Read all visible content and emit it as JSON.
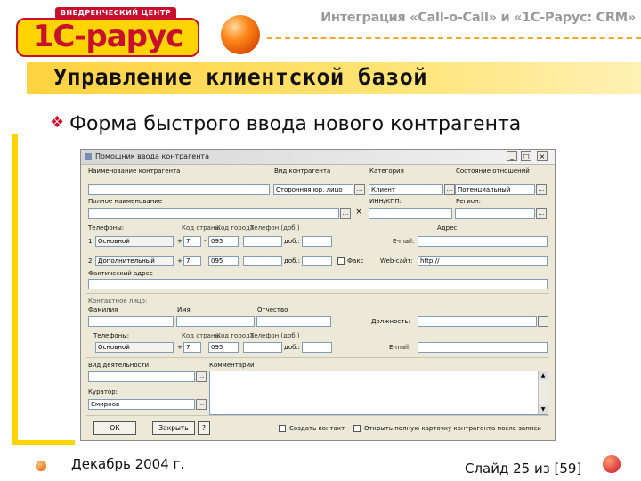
{
  "slide": {
    "logo_badge": "ВНЕДРЕНЧЕСКИЙ ЦЕНТР",
    "logo_brand": "1С-рарус",
    "header": "Интеграция «Call-o-Call» и «1С-Рарус: CRM»",
    "title": "Управление клиентской базой",
    "bullet_mark": "❖",
    "bullet": "Форма быстрого ввода нового контрагента",
    "footer_date": "Декабрь 2004 г.",
    "footer_slide": "Слайд 25 из [59]"
  },
  "colors": {
    "accent_yellow": "#ffd400",
    "accent_red": "#c8102e",
    "orange": "#f5a623"
  },
  "dialog": {
    "title": "Помощник ввода контрагента",
    "window_buttons": [
      "_",
      "□",
      "×"
    ],
    "labels": {
      "name": "Наименование контрагента",
      "kind": "Вид контрагента",
      "category": "Категория",
      "relation": "Состояние отношений",
      "full_name": "Полное наименование",
      "inn": "ИНН/КПП:",
      "region": "Регион:",
      "phones": "Телефоны:",
      "phone_hint_code": "Код страны",
      "phone_hint_city": "Код города",
      "phone_hint_number": "Телефон (доб.)",
      "address": "Адрес",
      "email": "E-mail:",
      "web": "Web-сайт:",
      "fax": "Факс",
      "actual_address": "Фактический адрес",
      "contact_section": "Контактное лицо:",
      "surname": "Фамилия",
      "firstname": "Имя",
      "patronymic": "Отчество",
      "position": "Должность:",
      "contact_phones": "Телефоны:",
      "contact_email": "E-mail:",
      "activity": "Вид деятельности:",
      "comments": "Комментарии",
      "curator": "Куратор:",
      "ext": "доб.:"
    },
    "values": {
      "kind": "Сторонняя юр. лицо",
      "category": "Клиент",
      "relation": "Потенциальный",
      "web": "http://",
      "curator": "Смирнов"
    },
    "phones": [
      {
        "num": "1",
        "type": "Основной",
        "plus": "+",
        "country": "7",
        "dash": "-",
        "city": "095"
      },
      {
        "num": "2",
        "type": "Дополнительный",
        "plus": "+",
        "country": "7",
        "dash": "",
        "city": "095"
      }
    ],
    "contact_phone": {
      "type": "Основной",
      "plus": "+",
      "country": "7",
      "city": "095"
    },
    "ellipsis": "...",
    "clear": "×",
    "checkboxes": {
      "save_contact": "Создать контакт",
      "open_card": "Открыть полную карточку контрагента после записи"
    },
    "buttons": {
      "ok": "ОК",
      "cancel": "Закрыть",
      "help": "?"
    }
  }
}
